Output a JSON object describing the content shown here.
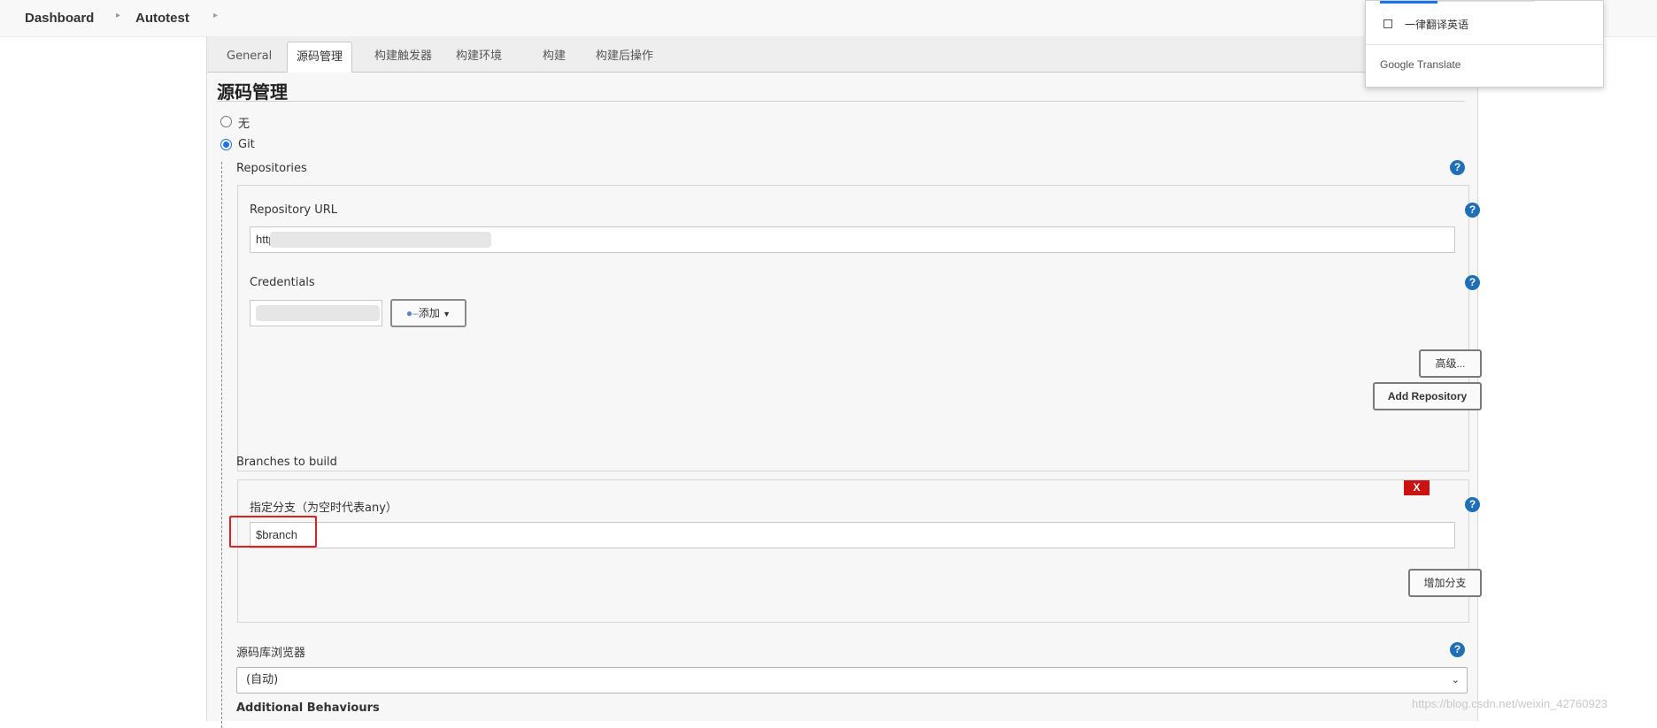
{
  "breadcrumb": {
    "items": [
      "Dashboard",
      "Autotest"
    ]
  },
  "tabs": [
    "General",
    "源码管理",
    "构建触发器",
    "构建环境",
    "构建",
    "构建后操作"
  ],
  "active_tab": "源码管理",
  "section_title": "源码管理",
  "scm_options": {
    "none": "无",
    "git": "Git",
    "selected": "Git"
  },
  "repositories": {
    "label": "Repositories",
    "repo_url_label": "Repository URL",
    "repo_url_value": "http",
    "credentials_label": "Credentials",
    "add_button": "添加",
    "advanced_button": "高级...",
    "add_repository_button": "Add Repository"
  },
  "branches": {
    "label": "Branches to build",
    "remove_button": "X",
    "specifier_label": "指定分支（为空时代表any）",
    "specifier_value": "$branch",
    "add_branch_button": "增加分支"
  },
  "repo_browser": {
    "label": "源码库浏览器",
    "selected": "(自动)"
  },
  "additional_behaviours": {
    "label": "Additional Behaviours"
  },
  "translate_popup": {
    "checkbox_label": "一律翻译英语",
    "brand": "Google",
    "brand_suffix": "Translate"
  },
  "watermark": "https://blog.csdn.net/weixin_42760923",
  "colors": {
    "help_icon": "#1e6fb8",
    "remove_button": "#cc1111",
    "highlight_box": "#e02020",
    "radio_selected": "#1a73e8"
  }
}
